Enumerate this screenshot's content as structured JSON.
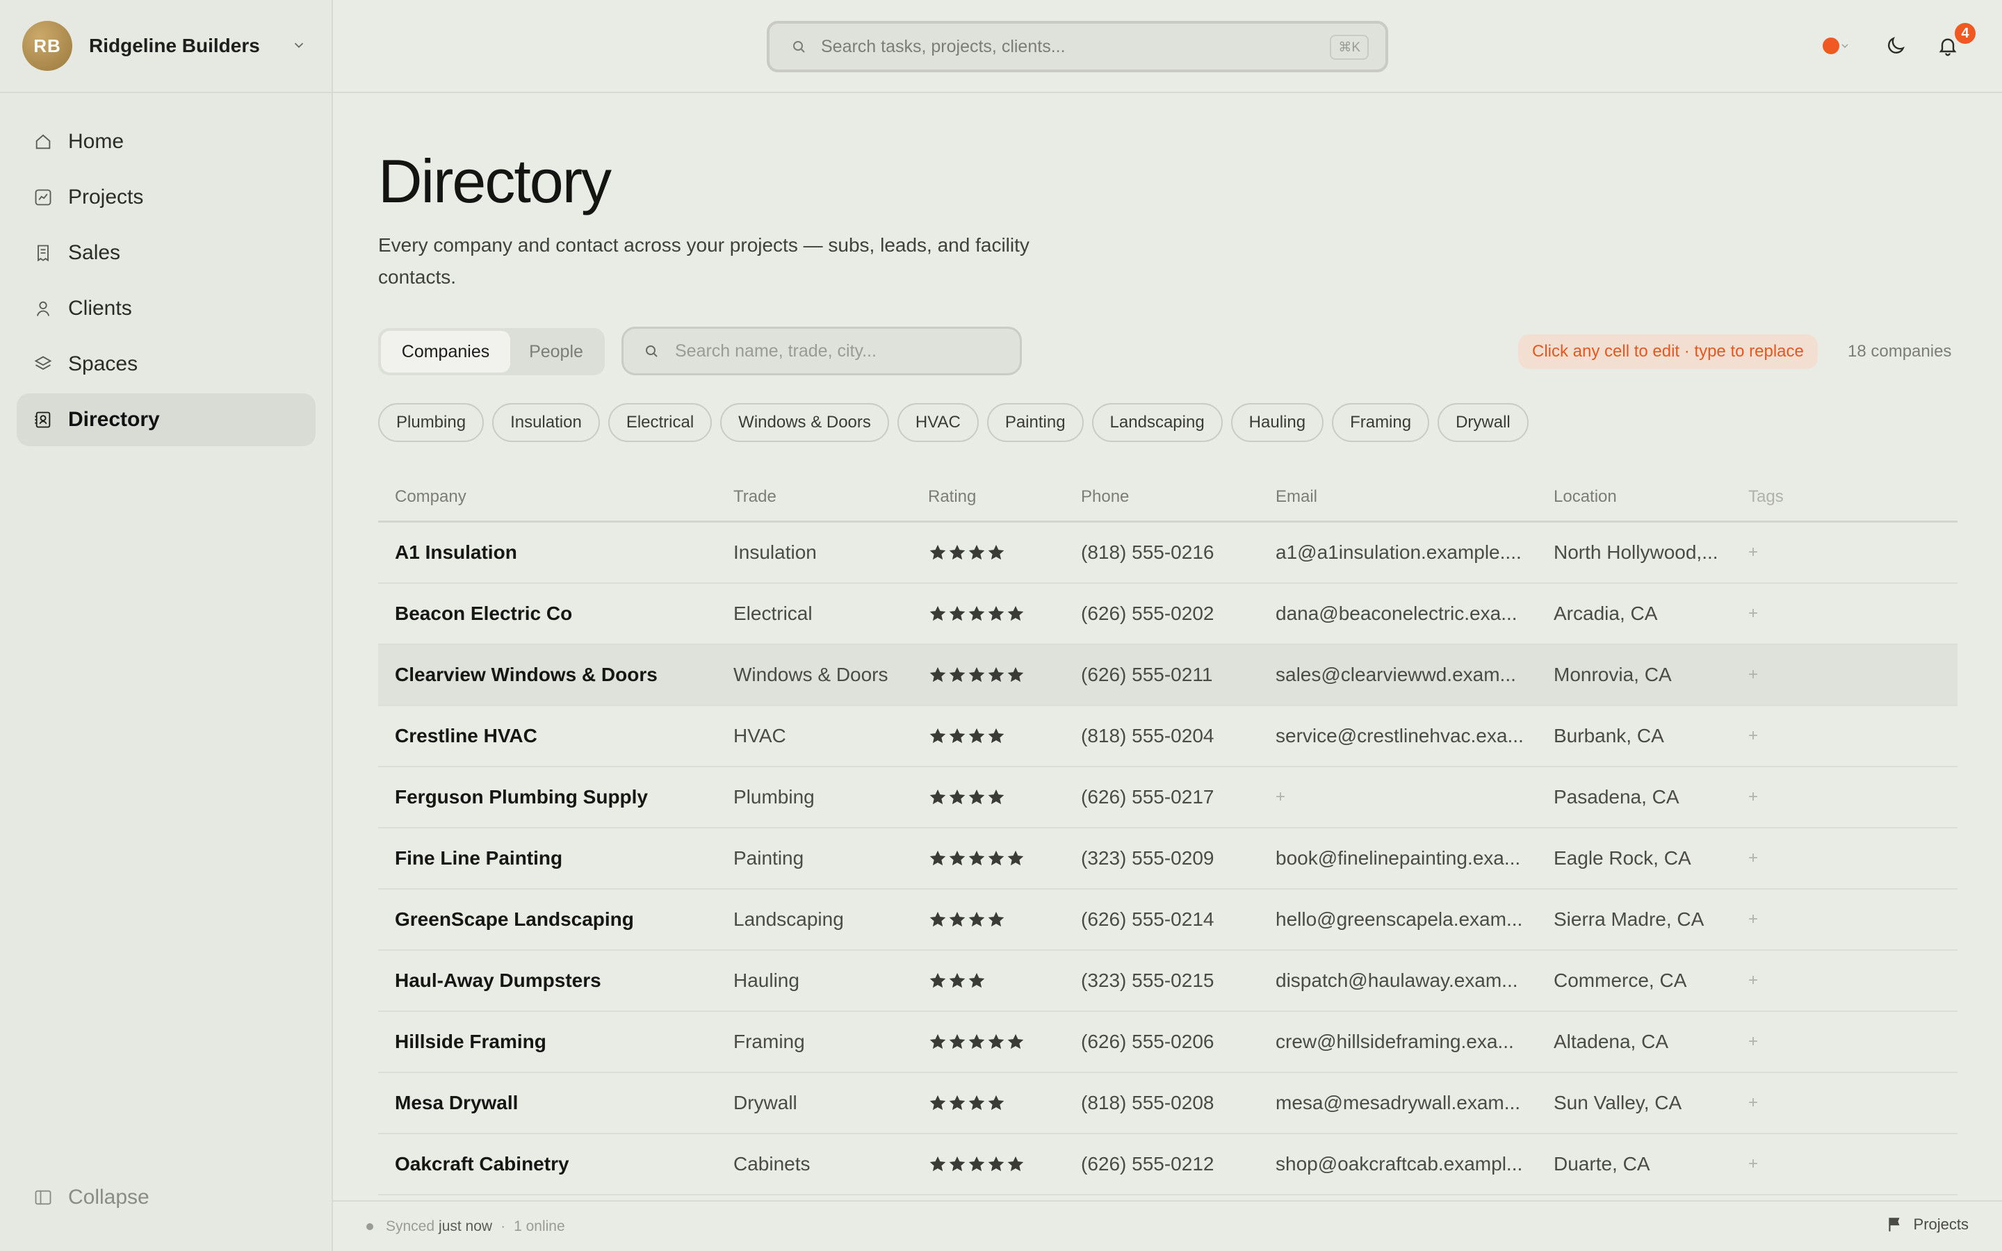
{
  "org": {
    "initials": "RB",
    "name": "Ridgeline Builders"
  },
  "nav": {
    "items": [
      {
        "label": "Home",
        "icon": "home-icon"
      },
      {
        "label": "Projects",
        "icon": "chart-icon"
      },
      {
        "label": "Sales",
        "icon": "receipt-icon"
      },
      {
        "label": "Clients",
        "icon": "user-icon"
      },
      {
        "label": "Spaces",
        "icon": "layers-icon"
      },
      {
        "label": "Directory",
        "icon": "contacts-icon",
        "active": true
      }
    ],
    "collapse_label": "Collapse"
  },
  "topbar": {
    "search_placeholder": "Search tasks, projects, clients...",
    "shortcut": "⌘K",
    "notification_count": "4",
    "status_color": "#f05a22"
  },
  "page": {
    "title": "Directory",
    "subtitle": "Every company and contact across your projects — subs, leads, and facility contacts.",
    "segments": {
      "companies": "Companies",
      "people": "People"
    },
    "search_placeholder": "Search name, trade, city...",
    "hint": "Click any cell to edit · type to replace",
    "count": "18 companies",
    "chips": [
      "Plumbing",
      "Insulation",
      "Electrical",
      "Windows & Doors",
      "HVAC",
      "Painting",
      "Landscaping",
      "Hauling",
      "Framing",
      "Drywall"
    ]
  },
  "table": {
    "columns": {
      "company": "Company",
      "trade": "Trade",
      "rating": "Rating",
      "phone": "Phone",
      "email": "Email",
      "location": "Location",
      "tags": "Tags"
    },
    "empty_marker": "+",
    "rows": [
      {
        "company": "A1 Insulation",
        "trade": "Insulation",
        "rating": 4,
        "phone": "(818) 555-0216",
        "email": "a1@a1insulation.example....",
        "location": "North Hollywood,..."
      },
      {
        "company": "Beacon Electric Co",
        "trade": "Electrical",
        "rating": 5,
        "phone": "(626) 555-0202",
        "email": "dana@beaconelectric.exa...",
        "location": "Arcadia, CA"
      },
      {
        "company": "Clearview Windows & Doors",
        "trade": "Windows & Doors",
        "rating": 5,
        "phone": "(626) 555-0211",
        "email": "sales@clearviewwd.exam...",
        "location": "Monrovia, CA"
      },
      {
        "company": "Crestline HVAC",
        "trade": "HVAC",
        "rating": 4,
        "phone": "(818) 555-0204",
        "email": "service@crestlinehvac.exa...",
        "location": "Burbank, CA"
      },
      {
        "company": "Ferguson Plumbing Supply",
        "trade": "Plumbing",
        "rating": 4,
        "phone": "(626) 555-0217",
        "email": "",
        "location": "Pasadena, CA"
      },
      {
        "company": "Fine Line Painting",
        "trade": "Painting",
        "rating": 5,
        "phone": "(323) 555-0209",
        "email": "book@finelinepainting.exa...",
        "location": "Eagle Rock, CA"
      },
      {
        "company": "GreenScape Landscaping",
        "trade": "Landscaping",
        "rating": 4,
        "phone": "(626) 555-0214",
        "email": "hello@greenscapela.exam...",
        "location": "Sierra Madre, CA"
      },
      {
        "company": "Haul-Away Dumpsters",
        "trade": "Hauling",
        "rating": 3,
        "phone": "(323) 555-0215",
        "email": "dispatch@haulaway.exam...",
        "location": "Commerce, CA"
      },
      {
        "company": "Hillside Framing",
        "trade": "Framing",
        "rating": 5,
        "phone": "(626) 555-0206",
        "email": "crew@hillsideframing.exa...",
        "location": "Altadena, CA"
      },
      {
        "company": "Mesa Drywall",
        "trade": "Drywall",
        "rating": 4,
        "phone": "(818) 555-0208",
        "email": "mesa@mesadrywall.exam...",
        "location": "Sun Valley, CA"
      },
      {
        "company": "Oakcraft Cabinetry",
        "trade": "Cabinets",
        "rating": 5,
        "phone": "(626) 555-0212",
        "email": "shop@oakcraftcab.exampl...",
        "location": "Duarte, CA"
      }
    ]
  },
  "footer": {
    "synced_label": "Synced",
    "synced_time": "just now",
    "online": "1 online",
    "right_label": "Projects"
  }
}
